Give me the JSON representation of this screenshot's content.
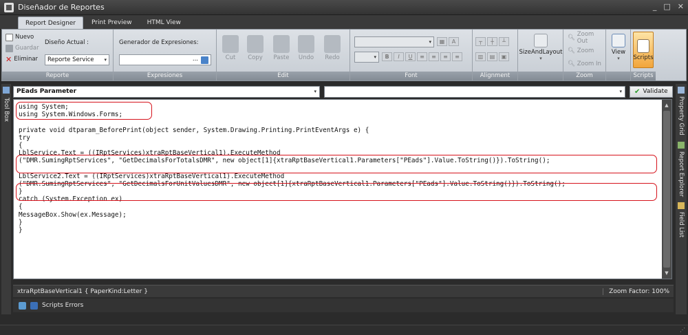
{
  "window": {
    "title": "Diseñador de Reportes",
    "controls": [
      "_",
      "□",
      "✕"
    ]
  },
  "tabs": [
    {
      "label": "Report Designer",
      "active": true
    },
    {
      "label": "Print Preview",
      "active": false
    },
    {
      "label": "HTML View",
      "active": false
    }
  ],
  "ribbon": {
    "reporte": {
      "label": "Reporte",
      "nuevo": "Nuevo",
      "guardar": "Guardar",
      "eliminar": "Eliminar",
      "diseno_label": "Diseño Actual :",
      "diseno_value": "Reporte Service"
    },
    "expresiones": {
      "label": "Expresiones",
      "generator_label": "Generador de Expresiones:",
      "ellipsis": "..."
    },
    "edit": {
      "label": "Edit",
      "cut": "Cut",
      "copy": "Copy",
      "paste": "Paste",
      "undo": "Undo",
      "redo": "Redo"
    },
    "font": {
      "label": "Font",
      "bold": "B",
      "italic": "I",
      "underline": "U"
    },
    "alignment": {
      "label": "Alignment"
    },
    "sizeandlayout": {
      "label": "SizeAndLayout"
    },
    "zoom": {
      "label": "Zoom",
      "zoom_out": "Zoom Out",
      "zoom": "Zoom",
      "zoom_in": "Zoom In"
    },
    "view": {
      "label": "View"
    },
    "scripts": {
      "label": "Scripts",
      "button": "Scripts"
    }
  },
  "sidebars": {
    "left": "Tool Box",
    "right": [
      "Property Grid",
      "Report Explorer",
      "Field List"
    ]
  },
  "editor": {
    "object_selector": "PEads  Parameter",
    "event_selector": "",
    "validate_label": "Validate",
    "lines": [
      "using System;",
      "using System.Windows.Forms;",
      "",
      "private void dtparam_BeforePrint(object sender, System.Drawing.Printing.PrintEventArgs e) {",
      "try",
      "{",
      "LblService.Text = ((IRptServices)xtraRptBaseVertical1).ExecuteMethod",
      "(\"DMR.SumingRptServices\", \"GetDecimalsForTotalsDMR\", new object[1]{xtraRptBaseVertical1.Parameters[\"PEads\"].Value.ToString()}).ToString();",
      "",
      "LblService2.Text = ((IRptServices)xtraRptBaseVertical1).ExecuteMethod",
      "(\"DMR.SumingRptServices\", \"GetDecimalsForUnitValuesDMR\", new object[1]{xtraRptBaseVertical1.Parameters[\"PEads\"].Value.ToString()}).ToString();",
      "}",
      "catch (System.Exception ex)",
      "{",
      "MessageBox.Show(ex.Message);",
      "}",
      "}"
    ]
  },
  "status": {
    "report": "xtraRptBaseVertical1 { PaperKind:Letter }",
    "zoom": "Zoom Factor: 100%"
  },
  "bottom_panel": {
    "tab": "Scripts Errors"
  },
  "colors": {
    "highlight": "#d6121b",
    "accent_scripts": "#f2a53b",
    "validate_check": "#2a9a2a"
  }
}
